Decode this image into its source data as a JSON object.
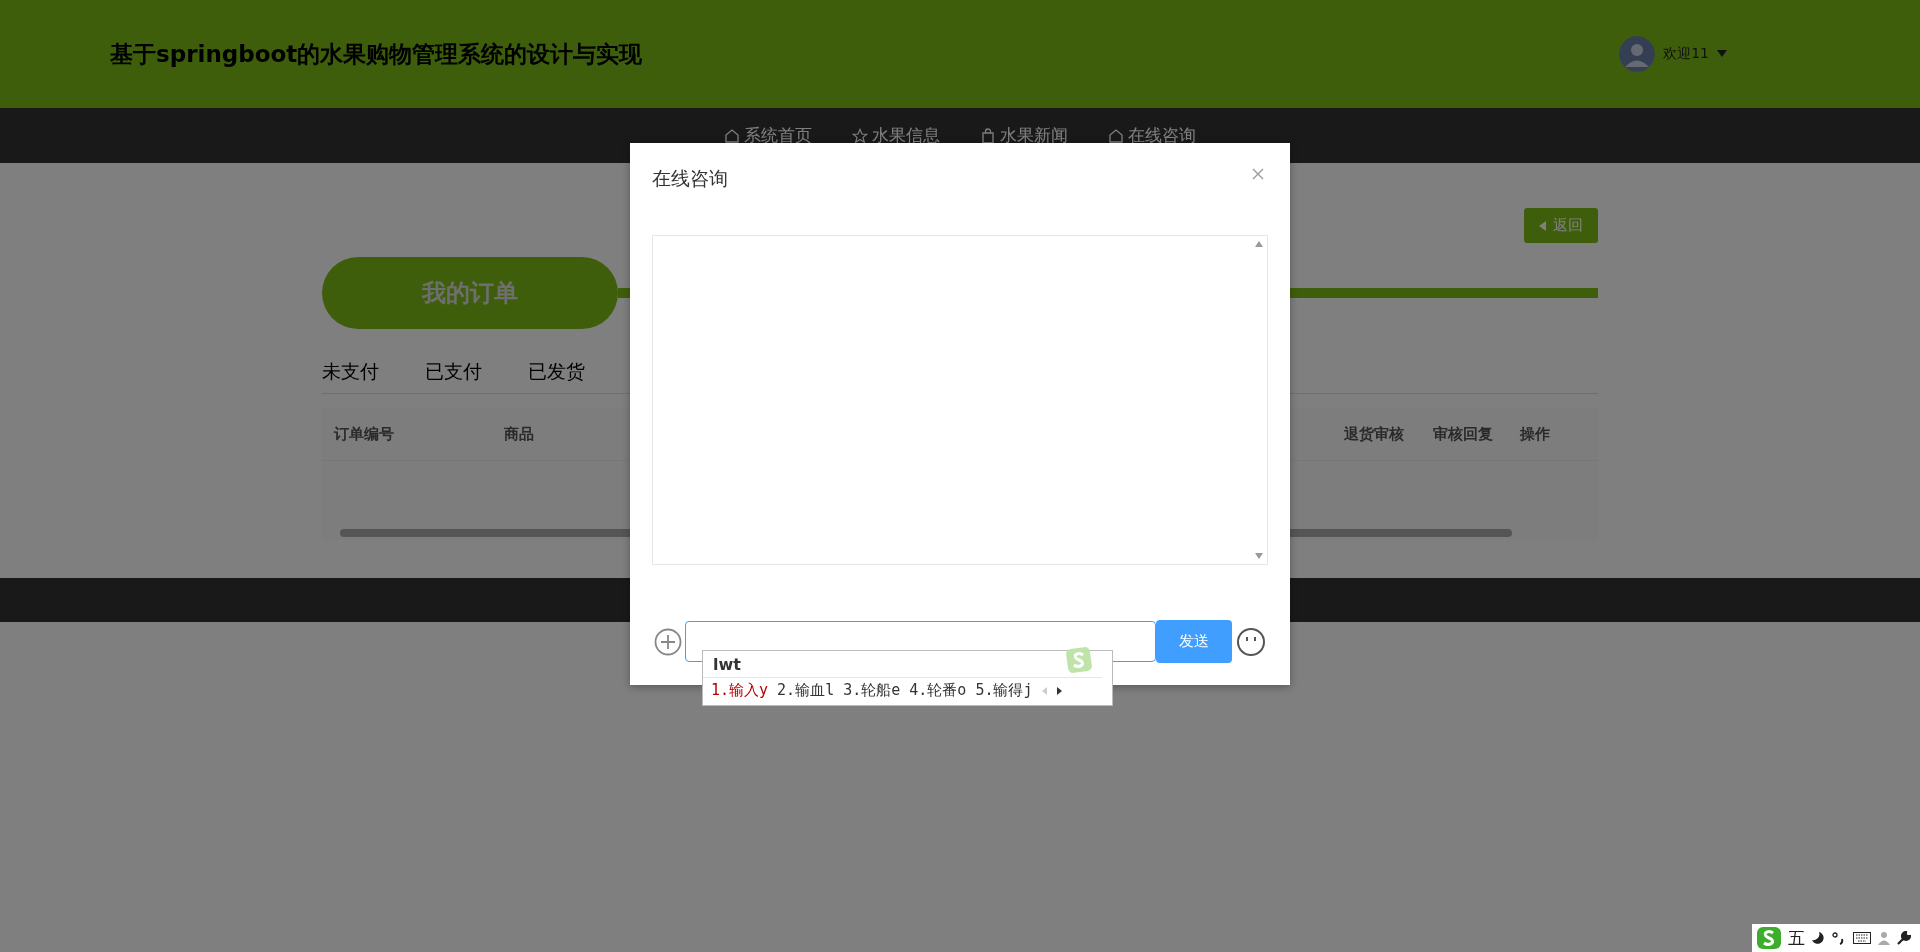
{
  "header": {
    "title": "基于springboot的水果购物管理系统的设计与实现",
    "user": "欢迎11"
  },
  "nav": [
    {
      "label": "系统首页",
      "kind": "home"
    },
    {
      "label": "水果信息",
      "kind": "star"
    },
    {
      "label": "水果新闻",
      "kind": "bag"
    },
    {
      "label": "在线咨询",
      "kind": "home"
    }
  ],
  "back_button": "返回",
  "section_title": "我的订单",
  "tabs": [
    {
      "label": "未支付",
      "selected": false
    },
    {
      "label": "已支付",
      "selected": false
    },
    {
      "label": "已发货",
      "selected": false
    }
  ],
  "table": {
    "columns": [
      "订单编号",
      "商品",
      "退货审核",
      "审核回复",
      "操作"
    ]
  },
  "dialog": {
    "title": "在线咨询",
    "send_button": "发送"
  },
  "ime": {
    "composition": "lwt",
    "candidates": [
      {
        "label": "1.输入y",
        "selected": true
      },
      {
        "label": "2.输血l",
        "selected": false
      },
      {
        "label": "3.轮船e",
        "selected": false
      },
      {
        "label": "4.轮番o",
        "selected": false
      },
      {
        "label": "5.输得j",
        "selected": false
      }
    ]
  },
  "ime_toolbar": {
    "mode": "五"
  }
}
